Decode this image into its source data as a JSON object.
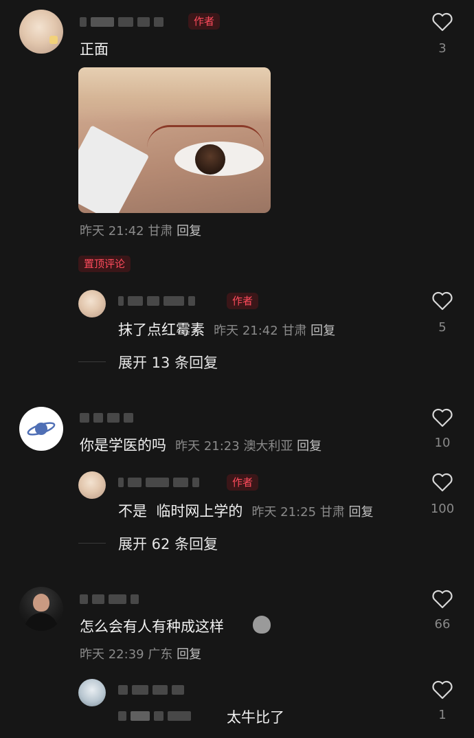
{
  "author_label": "作者",
  "pinned_label": "置顶评论",
  "reply_label": "回复",
  "comments": [
    {
      "text": "正面",
      "time": "昨天 21:42",
      "location": "甘肃",
      "likes": "3"
    },
    {
      "text": "抹了点红霉素",
      "time": "昨天 21:42",
      "location": "甘肃",
      "likes": "5",
      "expand": "展开 13 条回复"
    },
    {
      "text": "你是学医的吗",
      "time": "昨天 21:23",
      "location": "澳大利亚",
      "likes": "10"
    },
    {
      "text": "不是  临时网上学的",
      "time": "昨天 21:25",
      "location": "甘肃",
      "likes": "100",
      "expand": "展开 62 条回复"
    },
    {
      "text": "怎么会有人有种成这样",
      "time": "昨天 22:39",
      "location": "广东",
      "likes": "66"
    },
    {
      "text": "太牛比了",
      "likes": "1"
    }
  ],
  "colors": {
    "background": "#161616",
    "author_tag_bg": "#3a1618",
    "author_tag_text": "#ff4b5c"
  },
  "icons": [
    "heart-icon",
    "planet-icon",
    "smile-emoji-icon"
  ]
}
